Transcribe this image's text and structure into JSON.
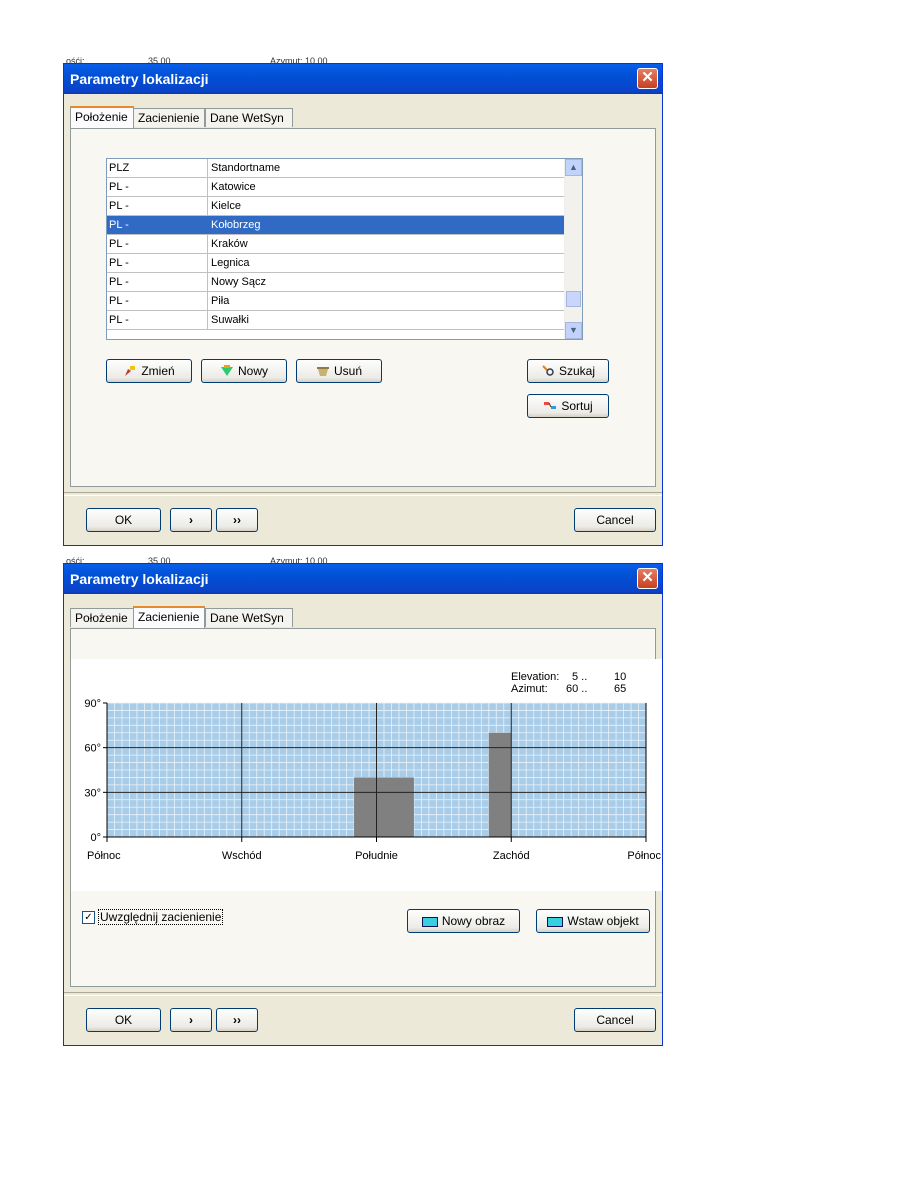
{
  "background": {
    "top1_left": "ośći:",
    "top1_mid": "35,00",
    "top1_right": "Azymut: 10,00",
    "top2_left": "ośći:",
    "top2_mid": "35,00",
    "top2_right": "Azymut: 10,00"
  },
  "dialog1": {
    "title": "Parametry lokalizacji",
    "close": "✕",
    "tabs": [
      "Położenie",
      "Zacienienie",
      "Dane WetSyn"
    ],
    "active_tab": 0,
    "list": {
      "headers": [
        "PLZ",
        "Standortname"
      ],
      "rows": [
        [
          "PL -",
          "Katowice"
        ],
        [
          "PL -",
          "Kielce"
        ],
        [
          "PL -",
          "Kołobrzeg"
        ],
        [
          "PL -",
          "Kraków"
        ],
        [
          "PL -",
          "Legnica"
        ],
        [
          "PL -",
          "Nowy Sącz"
        ],
        [
          "PL -",
          "Piła"
        ],
        [
          "PL -",
          "Suwałki"
        ]
      ],
      "selected_index": 2
    },
    "buttons": {
      "zmien": "Zmień",
      "nowy": "Nowy",
      "usun": "Usuń",
      "szukaj": "Szukaj",
      "sortuj": "Sortuj"
    },
    "footer": {
      "ok": "OK",
      "next": "›",
      "last": "››",
      "cancel": "Cancel"
    }
  },
  "dialog2": {
    "title": "Parametry lokalizacji",
    "close": "✕",
    "tabs": [
      "Położenie",
      "Zacienienie",
      "Dane WetSyn"
    ],
    "active_tab": 1,
    "info": {
      "elevation_label": "Elevation:",
      "elevation_from": "5 ..",
      "elevation_to": "10",
      "azimut_label": "Azimut:",
      "azimut_from": "60 ..",
      "azimut_to": "65"
    },
    "checkbox_label": "Uwzględnij zacienienie",
    "checkbox_checked": true,
    "buttons": {
      "nowy_obraz": "Nowy obraz",
      "wstaw_objekt": "Wstaw objekt"
    },
    "footer": {
      "ok": "OK",
      "next": "›",
      "last": "››",
      "cancel": "Cancel"
    }
  },
  "chart_data": {
    "type": "bar",
    "ylim": [
      0,
      90
    ],
    "yticks": [
      "90°",
      "60°",
      "30°",
      "0°"
    ],
    "ytick_values": [
      90,
      60,
      30,
      0
    ],
    "xticks": [
      "Północ",
      "Wschód",
      "Południe",
      "Zachód",
      "Północ"
    ],
    "xlim": [
      0,
      360
    ],
    "grid": true,
    "grid_color": "#b8d4ea",
    "bar_color": "#808080",
    "obstacles": [
      {
        "azimuth_from": 165,
        "azimuth_to": 205,
        "elevation": 40
      },
      {
        "azimuth_from": 255,
        "azimuth_to": 270,
        "elevation": 70
      }
    ]
  }
}
